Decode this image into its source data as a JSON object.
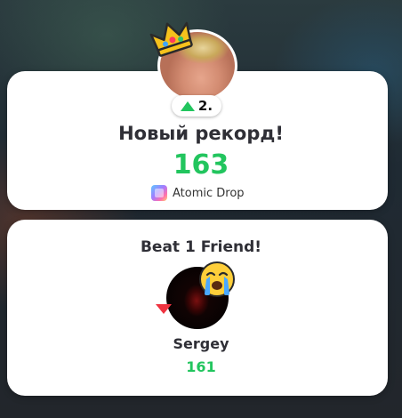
{
  "record": {
    "rank": "2.",
    "title": "Новый рекорд!",
    "score": "163",
    "game_name": "Atomic Drop",
    "score_color": "#22c55e"
  },
  "friend_section": {
    "title": "Beat 1 Friend!",
    "name": "Sergey",
    "score": "161",
    "rank_change": "down",
    "emoji": "crying-face"
  },
  "icons": {
    "crown": "crown-icon",
    "rank_up": "rank-up-arrow-icon",
    "rank_down": "rank-down-arrow-icon"
  }
}
